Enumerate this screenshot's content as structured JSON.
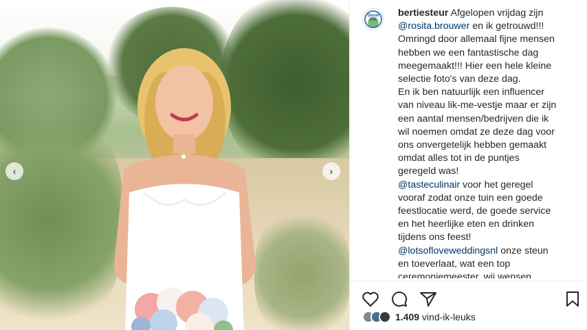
{
  "post": {
    "username": "bertiesteur",
    "avatar_text_line1": "Douw",
    "avatar_text_line2": "Pot",
    "caption": [
      {
        "segments": [
          {
            "type": "user",
            "text": "bertiesteur"
          },
          {
            "type": "text",
            "text": " Afgelopen vrijdag zijn "
          }
        ]
      },
      {
        "segments": [
          {
            "type": "mention",
            "text": "@rosita.brouwer"
          },
          {
            "type": "text",
            "text": " en ik getrouwd!!!"
          }
        ]
      },
      {
        "segments": [
          {
            "type": "text",
            "text": "Omringd door allemaal fijne mensen"
          }
        ]
      },
      {
        "segments": [
          {
            "type": "text",
            "text": "hebben we een fantastische dag"
          }
        ]
      },
      {
        "segments": [
          {
            "type": "text",
            "text": "meegemaakt!!! Hier een hele kleine"
          }
        ]
      },
      {
        "segments": [
          {
            "type": "text",
            "text": "selectie foto's van deze dag."
          }
        ]
      },
      {
        "segments": [
          {
            "type": "text",
            "text": "En ik ben natuurlijk een influencer"
          }
        ]
      },
      {
        "segments": [
          {
            "type": "text",
            "text": "van niveau lik-me-vestje maar er zijn"
          }
        ]
      },
      {
        "segments": [
          {
            "type": "text",
            "text": "een aantal mensen/bedrijven die ik"
          }
        ]
      },
      {
        "segments": [
          {
            "type": "text",
            "text": "wil noemen omdat ze deze dag voor"
          }
        ]
      },
      {
        "segments": [
          {
            "type": "text",
            "text": "ons onvergetelijk hebben gemaakt"
          }
        ]
      },
      {
        "segments": [
          {
            "type": "text",
            "text": "omdat alles tot in de puntjes"
          }
        ]
      },
      {
        "segments": [
          {
            "type": "text",
            "text": "geregeld was!"
          }
        ]
      },
      {
        "segments": [
          {
            "type": "mention",
            "text": "@tasteculinair"
          },
          {
            "type": "text",
            "text": " voor het geregel"
          }
        ]
      },
      {
        "segments": [
          {
            "type": "text",
            "text": "vooraf zodat onze tuin een goede"
          }
        ]
      },
      {
        "segments": [
          {
            "type": "text",
            "text": "feestlocatie werd, de goede service"
          }
        ]
      },
      {
        "segments": [
          {
            "type": "text",
            "text": "en het heerlijke eten en drinken"
          }
        ]
      },
      {
        "segments": [
          {
            "type": "text",
            "text": "tijdens ons feest!"
          }
        ]
      },
      {
        "segments": [
          {
            "type": "mention",
            "text": "@lotsofloveweddingsnl"
          },
          {
            "type": "text",
            "text": " onze steun"
          }
        ]
      },
      {
        "segments": [
          {
            "type": "text",
            "text": "en toeverlaat, wat een top"
          }
        ]
      },
      {
        "segments": [
          {
            "type": "text",
            "text": "ceremoniemeester, wij wensen"
          }
        ]
      }
    ],
    "likes_count": "1.409",
    "likes_suffix": " vind-ik-leuks",
    "icons": {
      "prev": "chevron-left-icon",
      "next": "chevron-right-icon",
      "like": "heart-icon",
      "comment": "comment-bubble-icon",
      "share": "paper-plane-icon",
      "save": "bookmark-icon"
    },
    "colors": {
      "mention": "#00376b",
      "text": "#262626",
      "divider": "#efefef"
    }
  }
}
